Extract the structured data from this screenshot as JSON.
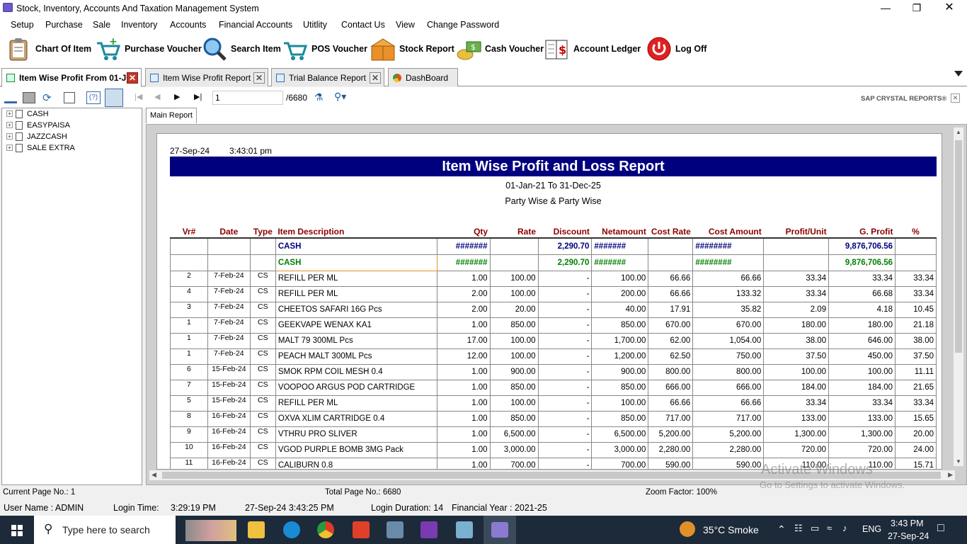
{
  "window": {
    "title": "Stock, Inventory, Accounts And Taxation Management System"
  },
  "menu": [
    "Setup",
    "Purchase",
    "Sale",
    "Inventory",
    "Accounts",
    "Financial Accounts",
    "Utitlity",
    "Contact Us",
    "View",
    "Change Password"
  ],
  "toolbar": {
    "chart_of_item": "Chart Of Item",
    "purchase_voucher": "Purchase Voucher",
    "search_item": "Search Item",
    "pos_voucher": "POS Voucher",
    "stock_report": "Stock Report",
    "cash_voucher": "Cash Voucher",
    "account_ledger": "Account Ledger",
    "log_off": "Log Off"
  },
  "tabs": [
    {
      "label": "Item Wise Profit From 01-J..."
    },
    {
      "label": "Item Wise Profit Report"
    },
    {
      "label": "Trial Balance Report"
    },
    {
      "label": "DashBoard"
    }
  ],
  "report_toolbar": {
    "page_input": "1",
    "page_total": "/6680",
    "brand": "SAP CRYSTAL REPORTS®"
  },
  "tree": [
    "CASH",
    "EASYPAISA",
    "JAZZCASH",
    "SALE EXTRA"
  ],
  "main_tab": "Main Report",
  "report": {
    "date": "27-Sep-24",
    "time": "3:43:01 pm",
    "title": "Item Wise Profit and Loss Report",
    "range": "01-Jan-21 To 31-Dec-25",
    "subtitle": "Party Wise & Party Wise",
    "columns": [
      "Vr#",
      "Date",
      "Type",
      "Item Description",
      "Qty",
      "Rate",
      "Discount",
      "Netamount",
      "Cost Rate",
      "Cost Amount",
      "Profit/Unit",
      "G. Profit",
      "%"
    ],
    "group1": {
      "desc": "CASH",
      "qty": "#######",
      "disc": "2,290.70",
      "net": "#######",
      "costamt": "########",
      "gprofit": "9,876,706.56"
    },
    "group2": {
      "desc": "CASH",
      "qty": "#######",
      "disc": "2,290.70",
      "net": "#######",
      "costamt": "########",
      "gprofit": "9,876,706.56"
    },
    "rows": [
      [
        "2",
        "7-Feb-24",
        "CS",
        "REFILL PER ML",
        "1.00",
        "100.00",
        "-",
        "100.00",
        "66.66",
        "66.66",
        "33.34",
        "33.34",
        "33.34"
      ],
      [
        "4",
        "7-Feb-24",
        "CS",
        "REFILL PER ML",
        "2.00",
        "100.00",
        "-",
        "200.00",
        "66.66",
        "133.32",
        "33.34",
        "66.68",
        "33.34"
      ],
      [
        "3",
        "7-Feb-24",
        "CS",
        "CHEETOS SAFARI 16G Pcs",
        "2.00",
        "20.00",
        "-",
        "40.00",
        "17.91",
        "35.82",
        "2.09",
        "4.18",
        "10.45"
      ],
      [
        "1",
        "7-Feb-24",
        "CS",
        "GEEKVAPE WENAX KA1",
        "1.00",
        "850.00",
        "-",
        "850.00",
        "670.00",
        "670.00",
        "180.00",
        "180.00",
        "21.18"
      ],
      [
        "1",
        "7-Feb-24",
        "CS",
        "MALT 79 300ML Pcs",
        "17.00",
        "100.00",
        "-",
        "1,700.00",
        "62.00",
        "1,054.00",
        "38.00",
        "646.00",
        "38.00"
      ],
      [
        "1",
        "7-Feb-24",
        "CS",
        "PEACH MALT 300ML Pcs",
        "12.00",
        "100.00",
        "-",
        "1,200.00",
        "62.50",
        "750.00",
        "37.50",
        "450.00",
        "37.50"
      ],
      [
        "6",
        "15-Feb-24",
        "CS",
        "SMOK RPM COIL MESH 0.4",
        "1.00",
        "900.00",
        "-",
        "900.00",
        "800.00",
        "800.00",
        "100.00",
        "100.00",
        "11.11"
      ],
      [
        "7",
        "15-Feb-24",
        "CS",
        "VOOPOO ARGUS POD CARTRIDGE",
        "1.00",
        "850.00",
        "-",
        "850.00",
        "666.00",
        "666.00",
        "184.00",
        "184.00",
        "21.65"
      ],
      [
        "5",
        "15-Feb-24",
        "CS",
        "REFILL PER ML",
        "1.00",
        "100.00",
        "-",
        "100.00",
        "66.66",
        "66.66",
        "33.34",
        "33.34",
        "33.34"
      ],
      [
        "8",
        "16-Feb-24",
        "CS",
        "OXVA XLIM CARTRIDGE 0.4",
        "1.00",
        "850.00",
        "-",
        "850.00",
        "717.00",
        "717.00",
        "133.00",
        "133.00",
        "15.65"
      ],
      [
        "9",
        "16-Feb-24",
        "CS",
        "VTHRU PRO SLIVER",
        "1.00",
        "6,500.00",
        "-",
        "6,500.00",
        "5,200.00",
        "5,200.00",
        "1,300.00",
        "1,300.00",
        "20.00"
      ],
      [
        "10",
        "16-Feb-24",
        "CS",
        "VGOD PURPLE BOMB 3MG Pack",
        "1.00",
        "3,000.00",
        "-",
        "3,000.00",
        "2,280.00",
        "2,280.00",
        "720.00",
        "720.00",
        "24.00"
      ],
      [
        "11",
        "16-Feb-24",
        "CS",
        "CALIBURN  0.8",
        "1.00",
        "700.00",
        "-",
        "700.00",
        "590.00",
        "590.00",
        "110.00",
        "110.00",
        "15.71"
      ]
    ]
  },
  "status": {
    "current_page": "Current Page No.: 1",
    "total_page": "Total Page No.: 6680",
    "zoom": "Zoom Factor: 100%"
  },
  "session": {
    "user": "User Name : ADMIN",
    "login_time_label": "Login Time:",
    "login_time": "3:29:19 PM",
    "datetime": "27-Sep-24 3:43:25 PM",
    "duration": "Login Duration: 14",
    "fy": "Financial Year : 2021-25"
  },
  "watermark": {
    "line1": "Activate Windows",
    "line2": "Go to Settings to activate Windows."
  },
  "taskbar": {
    "search": "Type here to search",
    "weather": "35°C  Smoke",
    "lang": "ENG",
    "time": "3:43 PM",
    "date": "27-Sep-24"
  }
}
